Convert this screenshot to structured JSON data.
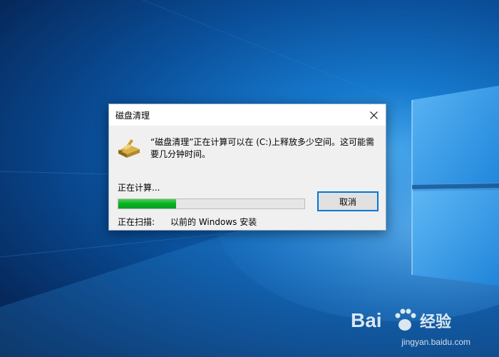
{
  "dialog": {
    "title": "磁盘清理",
    "message": "“磁盘清理”正在计算可以在 (C:)上释放多少空间。这可能需要几分钟时间。",
    "status_label": "正在计算...",
    "progress_fraction": 0.31,
    "scan_label": "正在扫描:",
    "scan_item": "以前的 Windows 安装",
    "cancel_label": "取消"
  },
  "watermark": {
    "brand": "Bai",
    "brand_suffix": "经验",
    "url": "jingyan.baidu.com"
  },
  "colors": {
    "progress_green": "#06b025",
    "button_focus_border": "#0078d7",
    "dialog_background": "#f0f0f0",
    "desktop_blue": "#0a4f9a"
  },
  "icons": {
    "drive": "disk-cleanup-icon",
    "close": "close-icon"
  }
}
